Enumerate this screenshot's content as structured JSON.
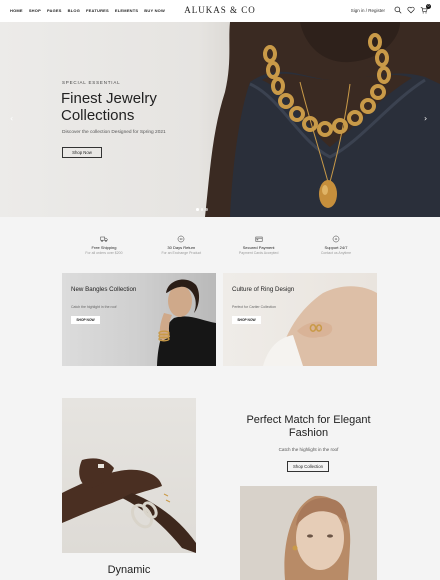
{
  "header": {
    "nav": [
      "HOME",
      "SHOP",
      "PAGES",
      "BLOG",
      "FEATURES",
      "ELEMENTS",
      "BUY NOW"
    ],
    "logo": "ALUKAS & CO",
    "signin": "Sign in / Register",
    "cart_count": "0",
    "icons": [
      "search-icon",
      "heart-icon",
      "cart-icon"
    ]
  },
  "hero": {
    "eyebrow": "SPECIAL ESSENTIAL",
    "title": "Finest Jewelry Collections",
    "subtitle": "Discover the collection Designed for Spring 2021",
    "button": "Shop Now",
    "prev_arrow": "‹",
    "next_arrow": "›",
    "slides": 3,
    "active_slide": 1
  },
  "features": [
    {
      "icon": "truck-icon",
      "title": "Free Shipping",
      "subtitle": "For all orders over $200"
    },
    {
      "icon": "return-icon",
      "title": "30 Days Return",
      "subtitle": "For an Exchange Product"
    },
    {
      "icon": "card-icon",
      "title": "Secured Payment",
      "subtitle": "Payment Cards Accepted"
    },
    {
      "icon": "support-icon",
      "title": "Support 24/7",
      "subtitle": "Contact us Anytime"
    }
  ],
  "collections": [
    {
      "title": "New Bangles Collection",
      "subtitle": "Catch the highlight in the roof",
      "button": "SHOP NOW"
    },
    {
      "title": "Culture of Ring Design",
      "subtitle": "Perfect for Cartier Collection",
      "button": "SHOP NOW"
    }
  ],
  "promo_left": {
    "title": "Dynamic"
  },
  "promo_right": {
    "title": "Perfect Match for Elegant Fashion",
    "subtitle": "Catch the highlight in the roof",
    "button": "Shop Collection"
  },
  "colors": {
    "accent": "#222222",
    "background": "#f4f4f4",
    "gold": "#c99a48",
    "sweater": "#2a2f3a"
  }
}
